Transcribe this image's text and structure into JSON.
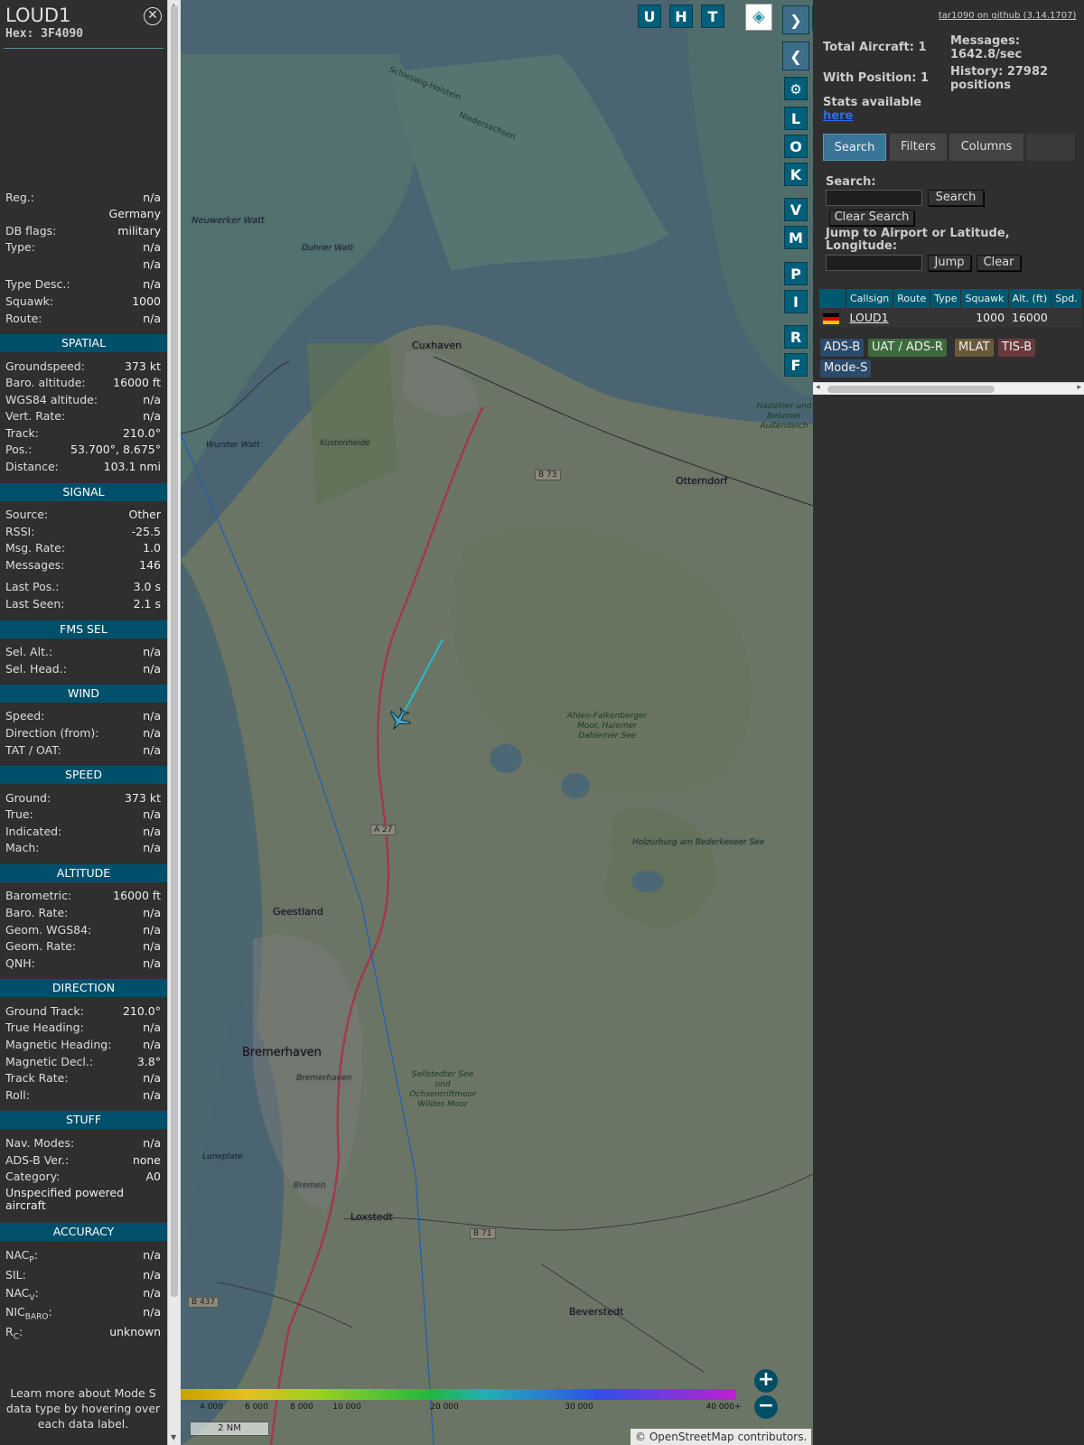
{
  "details": {
    "callsign": "LOUD1",
    "hex": "Hex: 3F4090",
    "close_icon": "close-icon",
    "basic": [
      {
        "label": "Reg.:",
        "value": "n/a"
      },
      {
        "label": "",
        "value": "Germany"
      },
      {
        "label": "DB flags:",
        "value": "military"
      },
      {
        "label": "Type:",
        "value": "n/a"
      },
      {
        "label": "",
        "value": "n/a"
      },
      {
        "label": "Type Desc.:",
        "value": "n/a"
      },
      {
        "label": "Squawk:",
        "value": "1000"
      },
      {
        "label": "Route:",
        "value": "n/a"
      }
    ],
    "spatial": {
      "title": "SPATIAL",
      "rows": [
        {
          "label": "Groundspeed:",
          "value": "373 kt"
        },
        {
          "label": "Baro. altitude:",
          "value": "16000 ft"
        },
        {
          "label": "WGS84 altitude:",
          "value": "n/a"
        },
        {
          "label": "Vert. Rate:",
          "value": "n/a"
        },
        {
          "label": "Track:",
          "value": "210.0°"
        },
        {
          "label": "Pos.:",
          "value": "53.700°, 8.675°"
        },
        {
          "label": "Distance:",
          "value": "103.1 nmi"
        }
      ]
    },
    "signal": {
      "title": "SIGNAL",
      "rows": [
        {
          "label": "Source:",
          "value": "Other"
        },
        {
          "label": "RSSI:",
          "value": "-25.5"
        },
        {
          "label": "Msg. Rate:",
          "value": "1.0"
        },
        {
          "label": "Messages:",
          "value": "146"
        },
        {
          "label": "Last Pos.:",
          "value": "3.0 s"
        },
        {
          "label": "Last Seen:",
          "value": "2.1 s"
        }
      ]
    },
    "fms": {
      "title": "FMS SEL",
      "rows": [
        {
          "label": "Sel. Alt.:",
          "value": "n/a"
        },
        {
          "label": "Sel. Head.:",
          "value": "n/a"
        }
      ]
    },
    "wind": {
      "title": "WIND",
      "rows": [
        {
          "label": "Speed:",
          "value": "n/a"
        },
        {
          "label": "Direction (from):",
          "value": "n/a"
        },
        {
          "label": "TAT / OAT:",
          "value": "n/a"
        }
      ]
    },
    "speed": {
      "title": "SPEED",
      "rows": [
        {
          "label": "Ground:",
          "value": "373 kt"
        },
        {
          "label": "True:",
          "value": "n/a"
        },
        {
          "label": "Indicated:",
          "value": "n/a"
        },
        {
          "label": "Mach:",
          "value": "n/a"
        }
      ]
    },
    "altitude": {
      "title": "ALTITUDE",
      "rows": [
        {
          "label": "Barometric:",
          "value": "16000 ft"
        },
        {
          "label": "Baro. Rate:",
          "value": "n/a"
        },
        {
          "label": "Geom. WGS84:",
          "value": "n/a"
        },
        {
          "label": "Geom. Rate:",
          "value": "n/a"
        },
        {
          "label": "QNH:",
          "value": "n/a"
        }
      ]
    },
    "direction": {
      "title": "DIRECTION",
      "rows": [
        {
          "label": "Ground Track:",
          "value": "210.0°"
        },
        {
          "label": "True Heading:",
          "value": "n/a"
        },
        {
          "label": "Magnetic Heading:",
          "value": "n/a"
        },
        {
          "label": "Magnetic Decl.:",
          "value": "3.8°"
        },
        {
          "label": "Track Rate:",
          "value": "n/a"
        },
        {
          "label": "Roll:",
          "value": "n/a"
        }
      ]
    },
    "stuff": {
      "title": "STUFF",
      "rows": [
        {
          "label": "Nav. Modes:",
          "value": "n/a"
        },
        {
          "label": "ADS-B Ver.:",
          "value": "none"
        },
        {
          "label": "Category:",
          "value": "A0"
        }
      ],
      "category_desc": "Unspecified powered aircraft"
    },
    "accuracy": {
      "title": "ACCURACY",
      "rows": [
        {
          "label": "NAC",
          "sub": "P",
          "value": "n/a"
        },
        {
          "label": "SIL:",
          "sub": "",
          "value": "n/a"
        },
        {
          "label": "NAC",
          "sub": "V",
          "value": "n/a"
        },
        {
          "label": "NIC",
          "sub": "BARO",
          "value": "n/a"
        },
        {
          "label": "R",
          "sub": "C",
          "value": "unknown"
        }
      ]
    },
    "learn_more": "Learn more about Mode S data type by hovering over each data label."
  },
  "map": {
    "buttons": [
      "U",
      "H",
      "T"
    ],
    "side_buttons": [
      "L",
      "O",
      "K",
      "V",
      "M",
      "P",
      "I",
      "R",
      "F"
    ],
    "settings_icon": "gear-icon",
    "layers_icon": "layers-icon",
    "place_labels": [
      "Cuxhaven",
      "Otterndorf",
      "Geestland",
      "Bremerhaven",
      "Loxstedt",
      "Beverstedt",
      "Kustenheide",
      "Neuwerker Watt",
      "Duhner Watt",
      "Wurster Watt",
      "Hadelner und Belumer Außendeich",
      "Ahlen-Falkenberger Moor, Halemer Dahlemer See",
      "Holzurburg am Bederkeseer See",
      "Sellstedter See und Ochsentriftmoor Wildes Moor",
      "Luneplate",
      "Bremen",
      "Bremerhaven"
    ],
    "road_labels": [
      "B 73",
      "A 27",
      "B 71",
      "B 437"
    ],
    "water_labels": [
      "Schleswig-Holstein",
      "Niedersachsen"
    ],
    "color_scale": [
      "4 000",
      "6 000",
      "8 000",
      "10 000",
      "20 000",
      "30 000",
      "40 000+"
    ],
    "scale_label": "2 NM",
    "attribution": "© OpenStreetMap contributors.",
    "zoom_in": "+",
    "zoom_out": "−"
  },
  "panel": {
    "github_link": "tar1090 on github (3.14.1707)",
    "total_aircraft": "Total Aircraft: 1",
    "with_position": "With Position: 1",
    "messages": "Messages: 1642.8/sec",
    "history": "History: 27982 positions",
    "stats_text": "Stats available",
    "stats_link": "here",
    "tabs": [
      "Search",
      "Filters",
      "Columns"
    ],
    "search_label": "Search:",
    "search_button": "Search",
    "clear_search_button": "Clear Search",
    "jump_label": "Jump to Airport or Latitude, Longitude:",
    "jump_button": "Jump",
    "clear_button": "Clear",
    "columns": [
      "Callsign",
      "Route",
      "Type",
      "Squawk",
      "Alt. (ft)",
      "Spd."
    ],
    "rows": [
      {
        "callsign": "LOUD1",
        "route": "",
        "type": "",
        "squawk": "1000",
        "alt": "16000",
        "spd": ""
      }
    ],
    "legend": [
      "ADS-B",
      "UAT / ADS-R",
      "MLAT",
      "TIS-B",
      "Mode-S"
    ],
    "colors": {
      "adsb": "#2c4a6a",
      "uat": "#3c6a3c",
      "mlat": "#6a5a3a",
      "tisb": "#6a3a3a",
      "modes": "#2c4a6a",
      "header": "#00586f"
    }
  }
}
